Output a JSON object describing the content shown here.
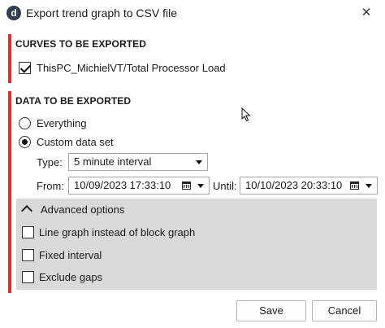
{
  "window": {
    "app_icon_letter": "d",
    "title": "Export trend graph to CSV file",
    "close_glyph": "✕"
  },
  "curves_section": {
    "heading": "CURVES TO BE EXPORTED",
    "curve": {
      "label": "ThisPC_MichielVT/Total Processor Load",
      "checked": true
    }
  },
  "data_section": {
    "heading": "DATA TO BE EXPORTED",
    "everything_label": "Everything",
    "everything_selected": false,
    "custom_label": "Custom data set",
    "custom_selected": true,
    "type_label": "Type:",
    "type_value": "5 minute interval",
    "from_label": "From:",
    "from_value": "10/09/2023 17:33:10",
    "until_label": "Until:",
    "until_value": "10/10/2023 20:33:10"
  },
  "advanced": {
    "header_label": "Advanced options",
    "expanded": true,
    "options": [
      {
        "label": "Line graph instead of block graph",
        "checked": false
      },
      {
        "label": "Fixed interval",
        "checked": false
      },
      {
        "label": "Exclude gaps",
        "checked": false
      }
    ]
  },
  "buttons": {
    "save_label": "Save",
    "cancel_label": "Cancel"
  },
  "colors": {
    "section_accent": "#d9342b",
    "advanced_panel_bg": "#d9d9d9"
  },
  "icons": [
    "app-logo-icon",
    "close-icon",
    "calendar-icon",
    "chevron-down-icon",
    "chevron-up-icon",
    "mouse-pointer-icon"
  ]
}
